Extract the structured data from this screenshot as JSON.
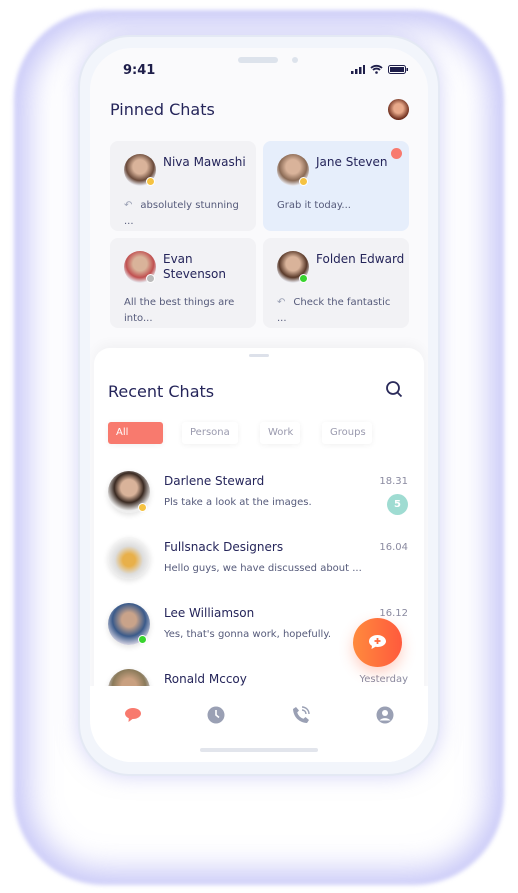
{
  "status": {
    "time": "9:41"
  },
  "pinned": {
    "title": "Pinned Chats",
    "chats": [
      {
        "name": "Niva Mawashi",
        "message": "absolutely stunning ...",
        "reply": true,
        "status": "#f5c242",
        "highlighted": false,
        "avatar": "#6a4a3a"
      },
      {
        "name": "Jane Steven",
        "message": "Grab it today...",
        "reply": false,
        "status": "#f5c242",
        "highlighted": true,
        "unread_dot": "#f87a6e",
        "avatar": "#8a6a55"
      },
      {
        "name": "Evan Stevenson",
        "message": "All the best things are into...",
        "reply": false,
        "status": "#bbbbbb",
        "highlighted": false,
        "avatar": "#c05050"
      },
      {
        "name": "Folden Edward",
        "message": "Check the fantastic ...",
        "reply": true,
        "status": "#38d42e",
        "highlighted": false,
        "avatar": "#5a3a2a"
      }
    ]
  },
  "recent": {
    "title": "Recent Chats",
    "filters": [
      "All",
      "Persona",
      "Work",
      "Groups"
    ],
    "active_filter": "All",
    "chats": [
      {
        "name": "Darlene Steward",
        "message": "Pls take a look at the images.",
        "time": "18.31",
        "badge": "5",
        "status": "#f5c242"
      },
      {
        "name": "Fullsnack Designers",
        "message": "Hello guys, we have discussed about ...",
        "time": "16.04"
      },
      {
        "name": "Lee Williamson",
        "message": "Yes, that's gonna work, hopefully.",
        "time": "16.12",
        "status": "#38d42e"
      },
      {
        "name": "Ronald Mccoy",
        "message": "",
        "time": "Yesterday"
      }
    ]
  },
  "nav": [
    "chats-icon",
    "clock-icon",
    "phone-icon",
    "profile-icon"
  ],
  "colors": {
    "accent": "#f87a6e",
    "fab": "#ff6a3d",
    "badge": "#9fdcd2",
    "text": "#25255a"
  }
}
